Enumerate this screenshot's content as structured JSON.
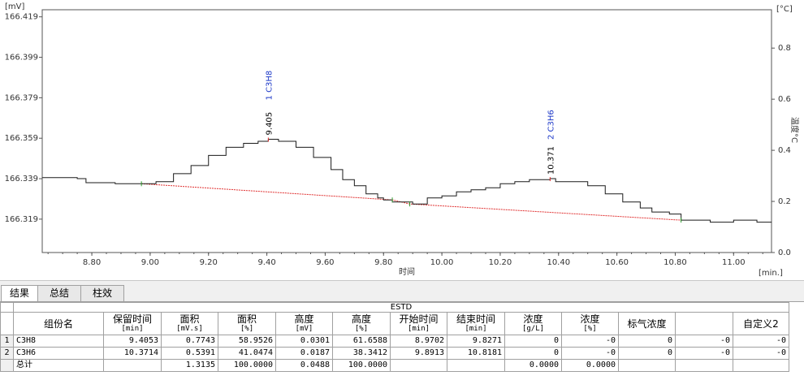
{
  "chart_data": {
    "type": "line",
    "title": "",
    "xlabel": "时间",
    "x_unit": "[min.]",
    "y_unit_left": "[mV]",
    "y_unit_right": "[°C]",
    "ylabel_right": "温度°C",
    "xlim": [
      8.63,
      11.13
    ],
    "ylim": [
      166.3025,
      166.4225
    ],
    "y2lim": [
      0,
      0.95
    ],
    "x_ticks": [
      "8.80",
      "9.00",
      "9.20",
      "9.40",
      "9.60",
      "9.80",
      "10.00",
      "10.20",
      "10.40",
      "10.60",
      "10.80",
      "11.00"
    ],
    "y_ticks": [
      "166.419",
      "166.399",
      "166.379",
      "166.359",
      "166.339",
      "166.319"
    ],
    "y2_ticks": [
      "0.8",
      "0.6",
      "0.4",
      "0.2",
      "0.0"
    ],
    "series": [
      {
        "name": "",
        "x": [
          8.63,
          8.75,
          8.78,
          8.85,
          8.88,
          8.97,
          9.02,
          9.08,
          9.14,
          9.2,
          9.26,
          9.32,
          9.37,
          9.405,
          9.44,
          9.5,
          9.56,
          9.62,
          9.66,
          9.7,
          9.74,
          9.78,
          9.8,
          9.83,
          9.87,
          9.9,
          9.95,
          10.0,
          10.05,
          10.1,
          10.15,
          10.2,
          10.25,
          10.3,
          10.35,
          10.371,
          10.39,
          10.45,
          10.5,
          10.56,
          10.62,
          10.68,
          10.72,
          10.78,
          10.82,
          10.86,
          10.92,
          10.96,
          11.0,
          11.04,
          11.08,
          11.13
        ],
        "y": [
          166.3395,
          166.339,
          166.337,
          166.337,
          166.3365,
          166.3365,
          166.3375,
          166.3415,
          166.3455,
          166.3505,
          166.3545,
          166.3565,
          166.3575,
          166.3585,
          166.3575,
          166.3545,
          166.3495,
          166.3435,
          166.3385,
          166.3355,
          166.3315,
          166.3295,
          166.3285,
          166.3275,
          166.3275,
          166.3265,
          166.3295,
          166.3305,
          166.3325,
          166.3335,
          166.3345,
          166.3365,
          166.3375,
          166.3385,
          166.3385,
          166.339,
          166.3375,
          166.3375,
          166.3355,
          166.3315,
          166.3275,
          166.3245,
          166.3225,
          166.3215,
          166.3185,
          166.3185,
          166.3175,
          166.3175,
          166.3185,
          166.3185,
          166.3175,
          166.3175
        ]
      }
    ],
    "baseline": {
      "x": [
        8.97,
        9.83,
        9.89,
        10.82
      ],
      "y": [
        166.3365,
        166.3285,
        166.3265,
        166.3185
      ]
    },
    "peak_labels": [
      {
        "rt": "9.405",
        "label": "1  C3H8",
        "x": 9.405,
        "y": 166.3585
      },
      {
        "rt": "10.371",
        "label": "2  C3H6",
        "x": 10.371,
        "y": 166.339
      }
    ],
    "colors": {
      "trace": "#1a1a1a",
      "baseline": "#e03030",
      "peak_name": "#1c38c8",
      "axis": "#555555"
    }
  },
  "tabs": [
    "结果",
    "总结",
    "柱效"
  ],
  "table": {
    "caption": "ESTD",
    "headers": [
      {
        "name": "组份名",
        "unit": ""
      },
      {
        "name": "保留时间",
        "unit": "[min]"
      },
      {
        "name": "面积",
        "unit": "[mV.s]"
      },
      {
        "name": "面积",
        "unit": "[%]"
      },
      {
        "name": "高度",
        "unit": "[mV]"
      },
      {
        "name": "高度",
        "unit": "[%]"
      },
      {
        "name": "开始时间",
        "unit": "[min]"
      },
      {
        "name": "结束时间",
        "unit": "[min]"
      },
      {
        "name": "浓度",
        "unit": "[g/L]"
      },
      {
        "name": "浓度",
        "unit": "[%]"
      },
      {
        "name": "标气浓度",
        "unit": ""
      },
      {
        "name": "",
        "unit": ""
      },
      {
        "name": "自定义2",
        "unit": ""
      }
    ],
    "rows": [
      [
        "1",
        "C3H8",
        "9.4053",
        "0.7743",
        "58.9526",
        "0.0301",
        "61.6588",
        "8.9702",
        "9.8271",
        "0",
        "-0",
        "0",
        "-0",
        "-0"
      ],
      [
        "2",
        "C3H6",
        "10.3714",
        "0.5391",
        "41.0474",
        "0.0187",
        "38.3412",
        "9.8913",
        "10.8181",
        "0",
        "-0",
        "0",
        "-0",
        "-0"
      ],
      [
        "",
        "总计",
        "",
        "1.3135",
        "100.0000",
        "0.0488",
        "100.0000",
        "",
        "",
        "0.0000",
        "0.0000",
        "",
        "",
        ""
      ]
    ]
  }
}
